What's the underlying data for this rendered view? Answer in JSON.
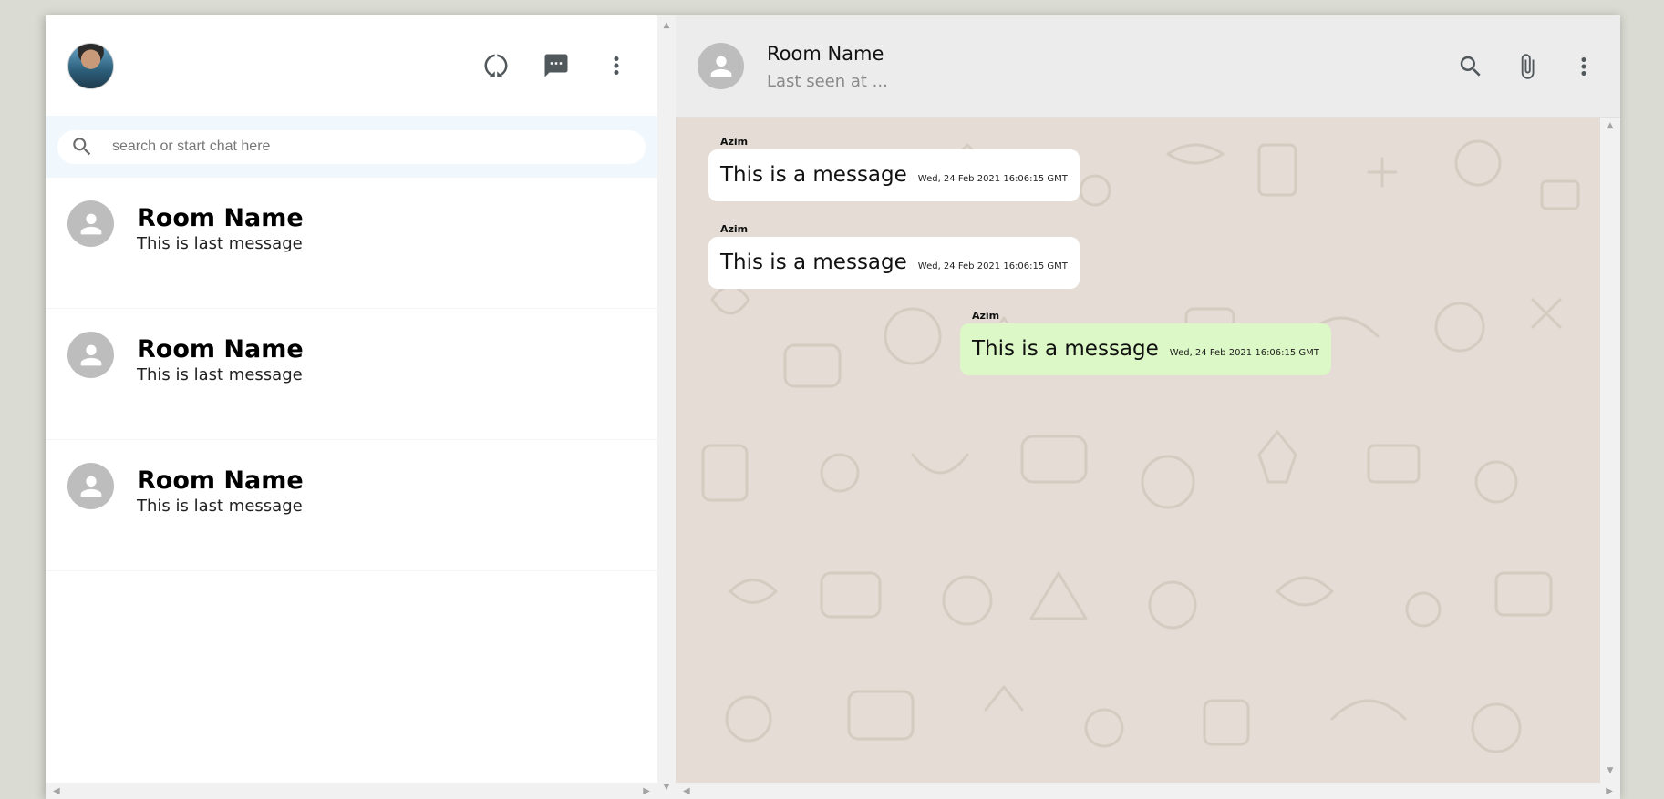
{
  "sidebar": {
    "search": {
      "placeholder": "search or start chat here",
      "value": ""
    },
    "rooms": [
      {
        "name": "Room Name",
        "last_message": "This is last message"
      },
      {
        "name": "Room Name",
        "last_message": "This is last message"
      },
      {
        "name": "Room Name",
        "last_message": "This is last message"
      }
    ],
    "icons": [
      "status-icon",
      "new-chat-icon",
      "more-vert-icon"
    ]
  },
  "chat": {
    "header": {
      "name": "Room Name",
      "last_seen": "Last seen at ..."
    },
    "icons": [
      "search-icon",
      "attach-icon",
      "more-vert-icon"
    ],
    "messages": [
      {
        "sender": "Azim",
        "text": "This is a message",
        "time": "Wed, 24 Feb 2021 16:06:15 GMT",
        "sent": false
      },
      {
        "sender": "Azim",
        "text": "This is a message",
        "time": "Wed, 24 Feb 2021 16:06:15 GMT",
        "sent": false
      },
      {
        "sender": "Azim",
        "text": "This is a message",
        "time": "Wed, 24 Feb 2021 16:06:15 GMT",
        "sent": true
      }
    ]
  },
  "colors": {
    "background": "#dadbd3",
    "sent_bubble": "#dcf8c6",
    "received_bubble": "#ffffff",
    "chat_wallpaper": "#e5ddd5",
    "search_bar": "#f0f8fe"
  },
  "scrollbar": {
    "up": "▲",
    "down": "▼",
    "left": "◀",
    "right": "▶"
  }
}
